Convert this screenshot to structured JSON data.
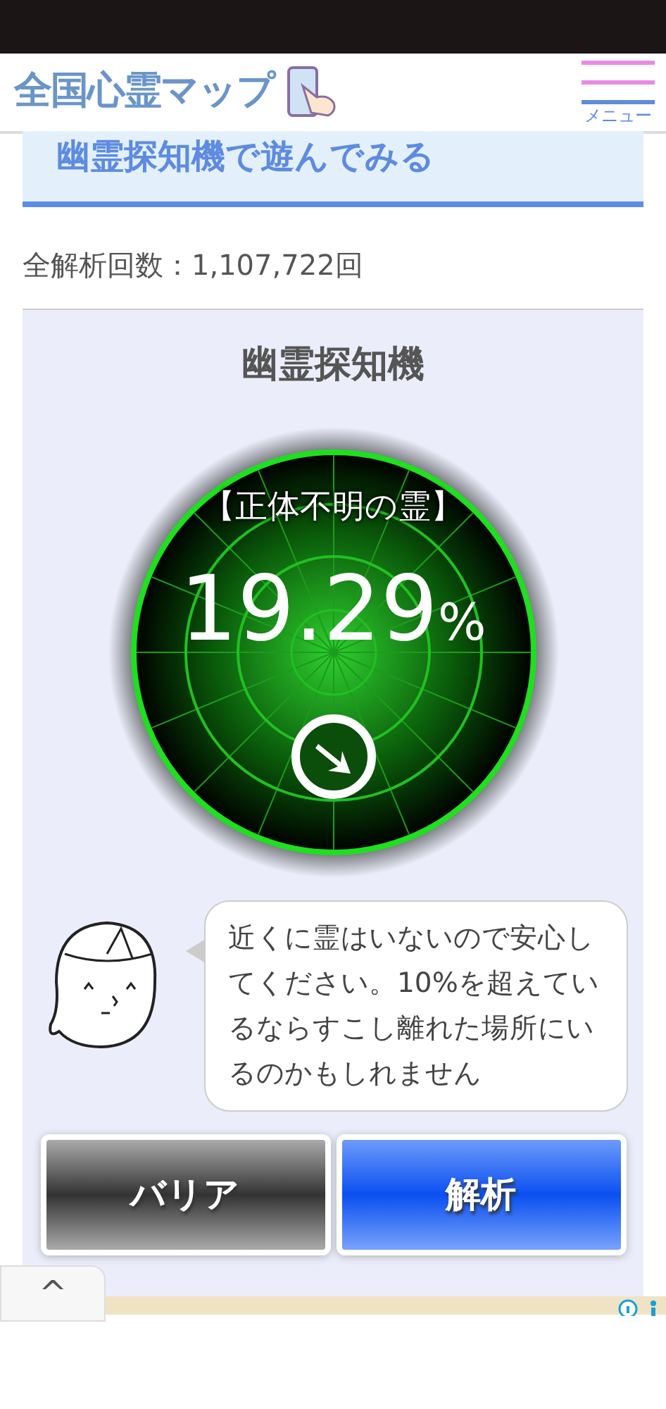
{
  "header": {
    "logo": "全国心霊マップ",
    "menu_label": "メニュー"
  },
  "section_title": "幽霊探知機で遊んでみる",
  "analysis_count": "全解析回数：1,107,722回",
  "detector": {
    "title": "幽霊探知機",
    "spirit": "【正体不明の霊】",
    "percent": "19.29",
    "unit": "%"
  },
  "message": "近くに霊はいないので安心してください。10%を超えているならすこし離れた場所にいるのかもしれません",
  "buttons": [
    {
      "label": "バリア",
      "kind": "barrier"
    },
    {
      "label": "解析",
      "kind": "analyze"
    }
  ],
  "back_to_top": "^"
}
